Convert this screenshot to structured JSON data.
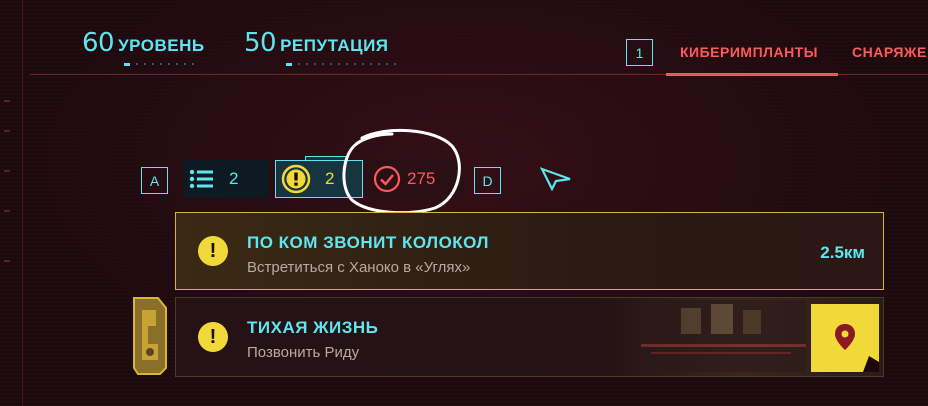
{
  "header": {
    "level": {
      "value": "60",
      "label": "УРОВЕНЬ"
    },
    "reputation": {
      "value": "50",
      "label": "РЕПУТАЦИЯ"
    },
    "tab_key": "1",
    "tabs": [
      "КИБЕРИМПЛАНТЫ",
      "СНАРЯЖЕ"
    ],
    "active_tab": "КИБЕРИМПЛАНТЫ"
  },
  "filters": {
    "prev_key": "A",
    "next_key": "D",
    "items": [
      {
        "icon": "list-icon",
        "count": "2"
      },
      {
        "icon": "exclamation-icon",
        "count": "2",
        "selected": true
      },
      {
        "icon": "checkmark-circle-icon",
        "count": "275"
      }
    ]
  },
  "quests": [
    {
      "title": "ПО КОМ ЗВОНИТ КОЛОКОЛ",
      "objective": "Встретиться с Ханоко в «Углях»",
      "distance": "2.5км",
      "icon": "exclamation-icon",
      "tracked": true
    },
    {
      "title": "ТИХАЯ ЖИЗНЬ",
      "objective": "Позвонить Риду",
      "icon": "exclamation-icon",
      "tracked": false,
      "action_icon": "map-pin-icon"
    }
  ],
  "colors": {
    "accent_cyan": "#5ee6f0",
    "accent_red": "#ff5a5a",
    "accent_yellow": "#f2d93a",
    "background": "#1c0a0e"
  }
}
